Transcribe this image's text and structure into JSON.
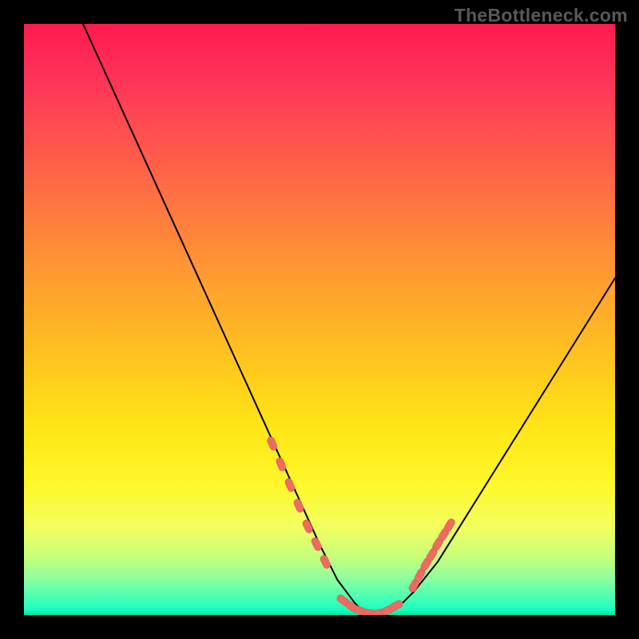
{
  "attribution": "TheBottleneck.com",
  "chart_data": {
    "type": "line",
    "title": "",
    "xlabel": "",
    "ylabel": "",
    "xlim": [
      0,
      100
    ],
    "ylim": [
      0,
      100
    ],
    "series": [
      {
        "name": "bottleneck-curve",
        "x": [
          10,
          15,
          20,
          25,
          30,
          35,
          40,
          45,
          50,
          53,
          56,
          58,
          60,
          63,
          66,
          70,
          75,
          80,
          85,
          90,
          95,
          100
        ],
        "y": [
          100,
          89,
          78,
          67,
          56,
          45,
          34,
          23,
          12,
          6,
          2,
          0,
          0,
          1,
          4,
          9,
          17,
          25,
          33,
          41,
          49,
          57
        ]
      }
    ],
    "highlighted_segments": [
      {
        "name": "left-cluster",
        "x": [
          42,
          43.5,
          45,
          46.5,
          48,
          49.5,
          51
        ],
        "y": [
          29,
          25.5,
          22,
          18.5,
          15,
          12,
          9
        ]
      },
      {
        "name": "bottom-cluster",
        "x": [
          54,
          55.5,
          57,
          58.5,
          60,
          61.5,
          63
        ],
        "y": [
          2.5,
          1.4,
          0.7,
          0.3,
          0.3,
          0.8,
          1.6
        ]
      },
      {
        "name": "right-cluster",
        "x": [
          66,
          67,
          68,
          69,
          70,
          71,
          72
        ],
        "y": [
          5,
          6.8,
          8.6,
          10.2,
          12,
          13.6,
          15.2
        ]
      }
    ],
    "colors": {
      "curve": "#000000",
      "marker_fill": "#ee6b63",
      "marker_stroke": "#d9564f"
    }
  }
}
